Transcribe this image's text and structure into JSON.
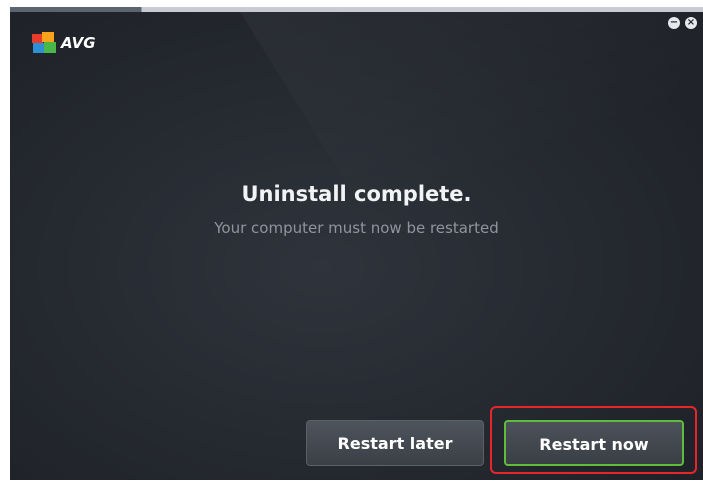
{
  "app": {
    "brand": "AVG",
    "icons": {
      "logo": "avg-four-color-logo-icon",
      "minimize": "minimize-icon",
      "close": "close-icon"
    },
    "minimize_glyph": "−",
    "close_glyph": "×"
  },
  "main": {
    "title": "Uninstall complete.",
    "subtitle": "Your computer must now be restarted"
  },
  "actions": {
    "restart_later_label": "Restart later",
    "restart_now_label": "Restart now"
  },
  "colors": {
    "background": "#262a31",
    "accent_green": "#5fbd3b",
    "highlight_red": "#e8262a"
  }
}
